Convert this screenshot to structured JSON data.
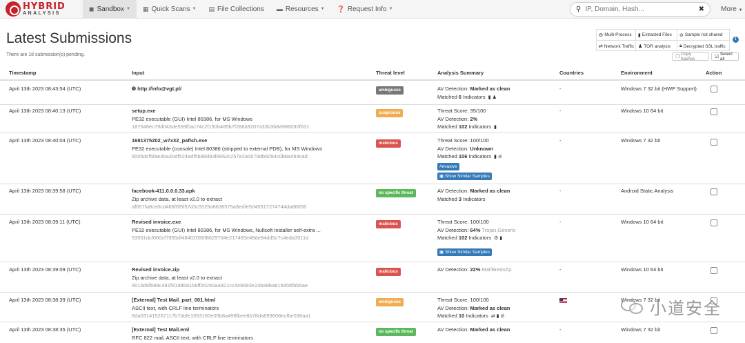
{
  "brand": {
    "line1": "HYBRID",
    "line2": "ANALYSIS"
  },
  "nav": [
    {
      "label": "Sandbox",
      "icon": "cube-icon",
      "glyph": "◼",
      "active": true
    },
    {
      "label": "Quick Scans",
      "icon": "quick-scan-icon",
      "glyph": "▦",
      "active": false
    },
    {
      "label": "File Collections",
      "icon": "file-icon",
      "glyph": "▤",
      "active": false
    },
    {
      "label": "Resources",
      "icon": "folder-icon",
      "glyph": "▬",
      "active": false
    },
    {
      "label": "Request Info",
      "icon": "question-icon",
      "glyph": "❓",
      "active": false
    }
  ],
  "search": {
    "placeholder": "IP, Domain, Hash..."
  },
  "more_label": "More",
  "page": {
    "title": "Latest Submissions",
    "pending": "There are 18 submission(s) pending."
  },
  "legend": {
    "multi_process": "Multi-Process",
    "extracted_files": "Extracted Files",
    "sample_not_shared": "Sample not shared",
    "network_traffic": "Network Traffic",
    "tor_analysis": "TOR analysis",
    "decrypted_ssl": "Decrypted SSL traffic"
  },
  "buttons": {
    "copy_hashes": "Copy hashes",
    "select_all": "Select all"
  },
  "columns": {
    "timestamp": "Timestamp",
    "input": "Input",
    "threat": "Threat level",
    "summary": "Analysis Summary",
    "countries": "Countries",
    "environment": "Environment",
    "action": "Action"
  },
  "rows": [
    {
      "timestamp": "April 13th 2023 08:43:54 (UTC)",
      "name": "http://info@vgt.pl/",
      "threat": "ambiguous",
      "line1": "AV Detection: ",
      "line1b": "Marked as clean",
      "line2": "Matched ",
      "line2b": "6",
      "line2c": " Indicators",
      "country": "-",
      "environment": "Windows 7 32 bit (HWP Support)"
    },
    {
      "timestamp": "April 13th 2023 08:40:13 (UTC)",
      "name": "setup.exe",
      "desc": "PE32 executable (GUI) Intel 80386, for MS Windows",
      "hash": "187546ec79d043de559f0ac74c2f150b485b7f286b9207a33b3b84986090f631",
      "threat": "suspicious",
      "line1": "Threat Score: 35/100",
      "line2": "AV Detection: ",
      "line2b": "2%",
      "line3": "Matched ",
      "line3b": "102",
      "line3c": " Indicators",
      "country": "-",
      "environment": "Windows 10 64 bit"
    },
    {
      "timestamp": "April 13th 2023 08:40:04 (UTC)",
      "name": "1681375202_w7x32_pafish.exe",
      "desc": "PE32 executable (console) Intel 80386 (stripped to external PDB), for MS Windows",
      "hash": "8005dcf5fae4ba30df524adf5b98d93f8962c257e2a0678db6094c0b8a494cad",
      "threat": "malicious",
      "line1": "Threat Score: 100/100",
      "line2": "AV Detection: ",
      "line2b": "Unknown",
      "line3": "Matched ",
      "line3b": "106",
      "line3c": " Indicators",
      "tag": "#evasive",
      "similar": "Show Similar Samples",
      "country": "-",
      "environment": "Windows 7 32 bit"
    },
    {
      "timestamp": "April 13th 2023 08:39:58 (UTC)",
      "name": "facebook-411.0.0.0.33.apk",
      "desc": "Zip archive data, at least v2.0 to extract",
      "hash": "af657fa8ce0cd466f0f5f57d3c5525a6636575a8edfe5045517274744da88056",
      "threat": "no specific threat",
      "line1": "AV Detection: ",
      "line1b": "Marked as clean",
      "line2": "Matched ",
      "line2b": "3",
      "line2c": " Indicators",
      "country": "-",
      "environment": "Android Static Analysis"
    },
    {
      "timestamp": "April 13th 2023 08:39:11 (UTC)",
      "name": "Revised invoice.exe",
      "desc": "PE32 executable (GUI) Intel 80386, for MS Windows, Nullsoft Installer self-extra ...",
      "hash": "53551dcf060cf7955df48402090f8629704e217465e48de84dd5c7c4eda3511d",
      "threat": "malicious",
      "line1": "Threat Score: 100/100",
      "line2": "AV Detection: ",
      "line2b": "64%",
      "line2c": " Trojan.Generic",
      "line3": "Matched ",
      "line3b": "102",
      "line3c": " Indicators",
      "similar": "Show Similar Samples",
      "country": "-",
      "environment": "Windows 10 64 bit"
    },
    {
      "timestamp": "April 13th 2023 08:39:09 (UTC)",
      "name": "Revised invoice.zip",
      "desc": "Zip archive data, at least v2.0 to extract",
      "hash": "9015d6fb88c481f91d8681b6ff26260aa921cc446683e24ba9ba81b95fdbb5ae",
      "threat": "malicious",
      "line1": "AV Detection: ",
      "line1b": "22%",
      "line1c": " Mal/BredoZp",
      "country": "-",
      "environment": "Windows 10 64 bit"
    },
    {
      "timestamp": "April 13th 2023 08:38:39 (UTC)",
      "name": "[External] Test Mail_part_001.html",
      "desc": "ASCII text, with CRLF line terminators",
      "hash": "8da031415267117b7bbfe1553160e05b8a498fbee8b78da893608ecfbe036aa1",
      "threat": "ambiguous",
      "line1": "Threat Score: 100/100",
      "line2": "AV Detection: ",
      "line2b": "Marked as clean",
      "line3": "Matched ",
      "line3b": "10",
      "line3c": " Indicators",
      "environment": "Windows 7 32 bit"
    },
    {
      "timestamp": "April 13th 2023 08:38:35 (UTC)",
      "name": "[External] Test Mail.eml",
      "desc": "RFC 822 mail, ASCII text, with CRLF line terminators",
      "threat": "no specific threat",
      "line1": "AV Detection: ",
      "line1b": "Marked as clean",
      "country": "-",
      "environment": "Windows 7 32 bit"
    }
  ],
  "watermark": "小道安全",
  "colors": {
    "ambiguous": "#777777",
    "suspicious": "#f0ad4e",
    "malicious": "#d9534f",
    "no_threat": "#5cb85c",
    "primary": "#337ab7",
    "brand": "#c7222a"
  }
}
